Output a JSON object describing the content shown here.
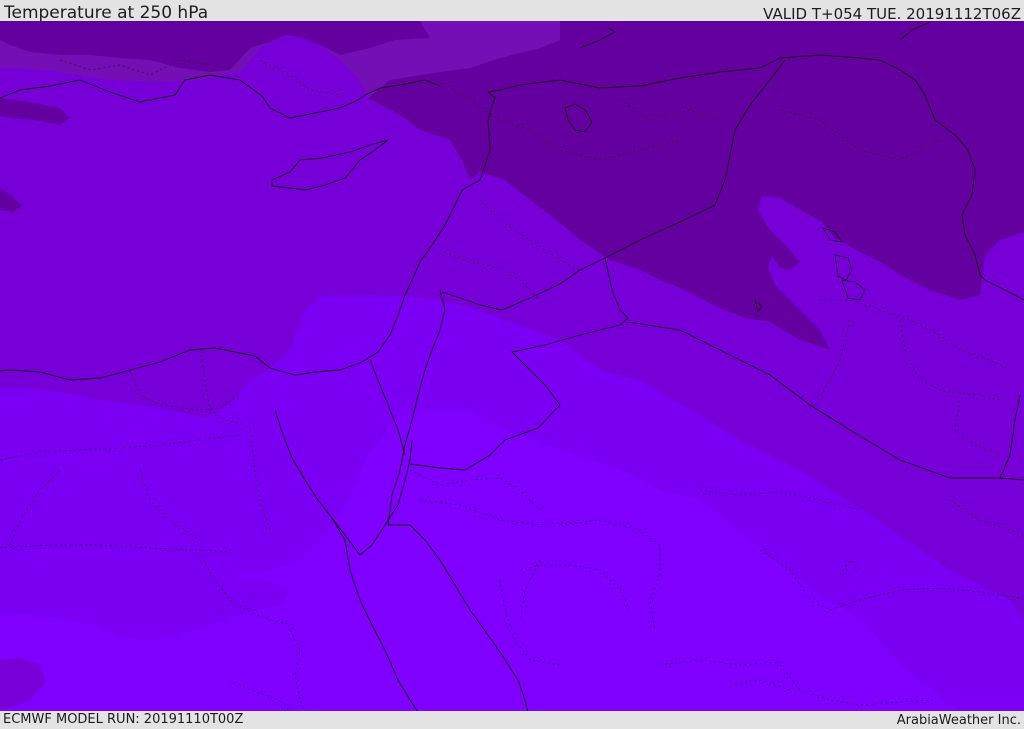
{
  "header": {
    "title": "Temperature at 250 hPa",
    "valid_time": "VALID T+054 TUE. 20191112T06Z"
  },
  "footer": {
    "model_run": "ECMWF MODEL RUN: 20191110T00Z",
    "credit": "ArabiaWeather Inc."
  },
  "map": {
    "field_colors": {
      "coldest": "#6500a0",
      "cold": "#730fb5",
      "mid": "#7700d9",
      "warm": "#7b00f3",
      "warmest": "#7f00ff"
    },
    "line_colors": {
      "coast": "#141414",
      "border": "#141414"
    }
  }
}
